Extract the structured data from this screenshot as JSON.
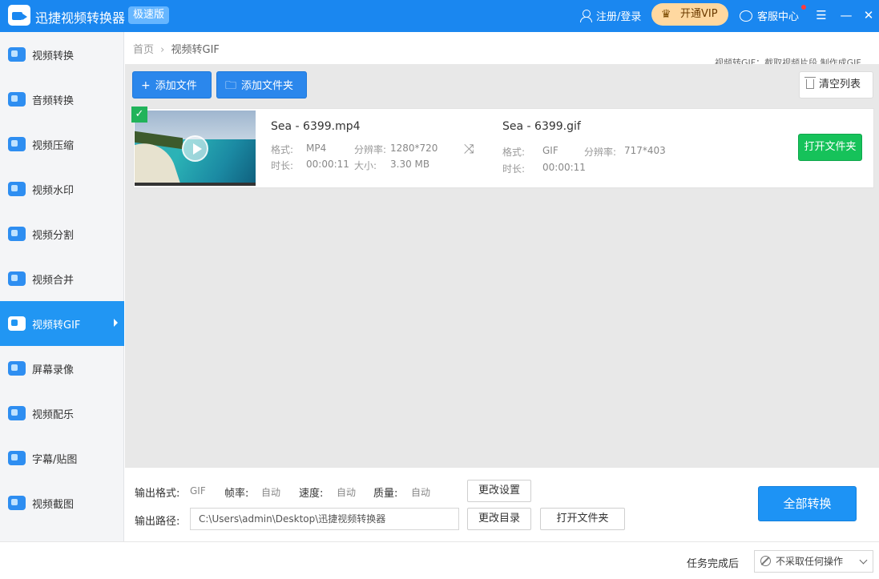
{
  "app": {
    "title": "迅捷视频转换器",
    "edition": "极速版",
    "login": "注册/登录",
    "vip": "开通VIP",
    "service": "客服中心"
  },
  "sidebar": {
    "items": [
      {
        "label": "视频转换",
        "icon": "video-convert-icon"
      },
      {
        "label": "音频转换",
        "icon": "audio-convert-icon"
      },
      {
        "label": "视频压缩",
        "icon": "video-compress-icon"
      },
      {
        "label": "视频水印",
        "icon": "video-watermark-icon"
      },
      {
        "label": "视频分割",
        "icon": "video-split-icon"
      },
      {
        "label": "视频合并",
        "icon": "video-merge-icon"
      },
      {
        "label": "视频转GIF",
        "icon": "video-gif-icon",
        "active": true
      },
      {
        "label": "屏幕录像",
        "icon": "screen-record-icon"
      },
      {
        "label": "视频配乐",
        "icon": "video-music-icon"
      },
      {
        "label": "字幕/贴图",
        "icon": "subtitle-sticker-icon"
      },
      {
        "label": "视频截图",
        "icon": "video-screenshot-icon"
      }
    ]
  },
  "breadcrumb": {
    "home": "首页",
    "current": "视频转GIF"
  },
  "header_hint": "视频转GIF：截取视频片段 制作成GIF",
  "toolbar": {
    "add_file": "添加文件",
    "add_folder": "添加文件夹",
    "clear_list": "清空列表"
  },
  "file": {
    "source_name": "Sea - 6399.mp4",
    "format_label": "格式:",
    "format": "MP4",
    "resolution_label": "分辨率:",
    "resolution": "1280*720",
    "duration_label": "时长:",
    "duration": "00:00:11",
    "size_label": "大小:",
    "size": "3.30 MB",
    "output_name": "Sea - 6399.gif",
    "output_format": "GIF",
    "output_resolution": "717*403",
    "output_duration": "00:00:11",
    "open_folder": "打开文件夹"
  },
  "settings": {
    "format_label": "输出格式:",
    "format": "GIF",
    "fps_label": "帧率:",
    "fps": "自动",
    "speed_label": "速度:",
    "speed": "自动",
    "quality_label": "质量:",
    "quality": "自动",
    "change_settings": "更改设置",
    "path_label": "输出路径:",
    "path": "C:\\Users\\admin\\Desktop\\迅捷视频转换器",
    "change_dir": "更改目录",
    "open_folder": "打开文件夹",
    "convert_all": "全部转换"
  },
  "status": {
    "after_label": "任务完成后",
    "after_value": "不采取任何操作"
  },
  "colors": {
    "primary": "#1a87f0",
    "accent_green": "#16c25a",
    "vip_gold": "#ffd8a0"
  }
}
